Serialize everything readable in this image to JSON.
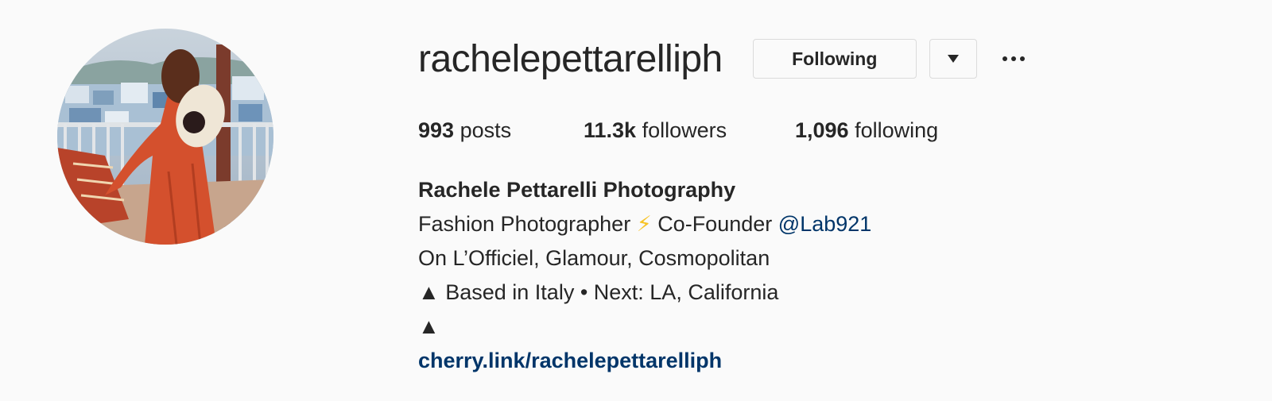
{
  "profile": {
    "username": "rachelepettarelliph",
    "following_button_label": "Following",
    "dropdown_icon": "caret-down-icon",
    "more_icon": "ellipsis-icon",
    "avatar": "profile-photo"
  },
  "stats": {
    "posts_count": "993",
    "posts_label": "posts",
    "followers_count": "11.3k",
    "followers_label": "followers",
    "following_count": "1,096",
    "following_label": "following"
  },
  "bio": {
    "full_name": "Rachele Pettarelli Photography",
    "line1_text": "Fashion Photographer",
    "line1_emoji": "⚡",
    "line1_after": "Co-Founder",
    "line1_mention": "@Lab921",
    "line2": "On L’Officiel, Glamour, Cosmopolitan",
    "line3": "▲ Based in Italy • Next: LA, California",
    "line4": "▲",
    "website": "cherry.link/rachelepettarelliph"
  },
  "colors": {
    "link": "#003569",
    "text": "#262626",
    "border": "#dbdbdb",
    "background": "#fafafa"
  }
}
